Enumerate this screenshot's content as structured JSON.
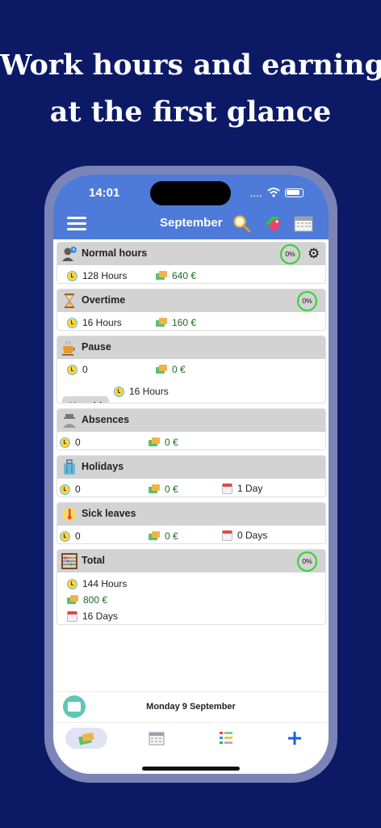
{
  "headline": [
    "Work hours and earning",
    "at the first glance"
  ],
  "status": {
    "time": "14:01"
  },
  "app_bar": {
    "title": "September"
  },
  "cards": {
    "normal": {
      "title": "Normal hours",
      "percent": "0%",
      "hours": "128 Hours",
      "money": "640 €"
    },
    "overtime": {
      "title": "Overtime",
      "percent": "0%",
      "hours": "16 Hours",
      "money": "160 €"
    },
    "pause": {
      "title": "Pause",
      "hours": "0",
      "money": "0 €",
      "unpaid_label": "Unpaid",
      "unpaid_hours": "16 Hours"
    },
    "absences": {
      "title": "Absences",
      "hours": "0",
      "money": "0 €"
    },
    "holidays": {
      "title": "Holidays",
      "hours": "0",
      "money": "0 €",
      "days": "1 Day"
    },
    "sick": {
      "title": "Sick leaves",
      "hours": "0",
      "money": "0 €",
      "days": "0 Days"
    },
    "total": {
      "title": "Total",
      "percent": "0%",
      "hours": "144 Hours",
      "money": "800 €",
      "days": "16 Days"
    }
  },
  "date_strip": {
    "date": "Monday 9 September"
  },
  "colors": {
    "accent": "#4e7ad9",
    "background": "#0c1a66",
    "percent_ring": "#2fd32f",
    "money_text": "#1c6b22"
  }
}
